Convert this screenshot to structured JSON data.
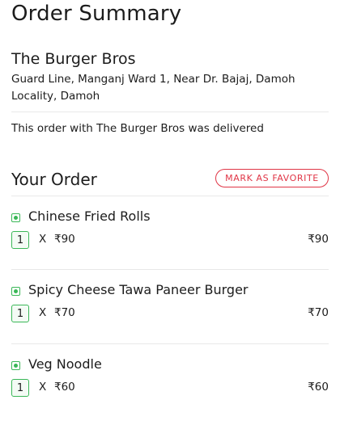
{
  "page": {
    "title": "Order Summary"
  },
  "restaurant": {
    "name": "The Burger Bros",
    "address": "Guard Line, Manganj Ward 1, Near Dr. Bajaj, Damoh Locality, Damoh"
  },
  "status": {
    "text": "This order with The Burger Bros was delivered"
  },
  "your_order": {
    "title": "Your Order",
    "favorite_label": "MARK AS FAVORITE",
    "accent_color": "#e03546",
    "veg_color": "#3ab757",
    "items": [
      {
        "name": "Chinese Fried Rolls",
        "qty": "1",
        "x": "X",
        "unit_price": "₹90",
        "total": "₹90",
        "icon": "veg-icon"
      },
      {
        "name": "Spicy Cheese Tawa Paneer Burger",
        "qty": "1",
        "x": "X",
        "unit_price": "₹70",
        "total": "₹70",
        "icon": "veg-icon"
      },
      {
        "name": "Veg Noodle",
        "qty": "1",
        "x": "X",
        "unit_price": "₹60",
        "total": "₹60",
        "icon": "veg-icon"
      }
    ]
  }
}
